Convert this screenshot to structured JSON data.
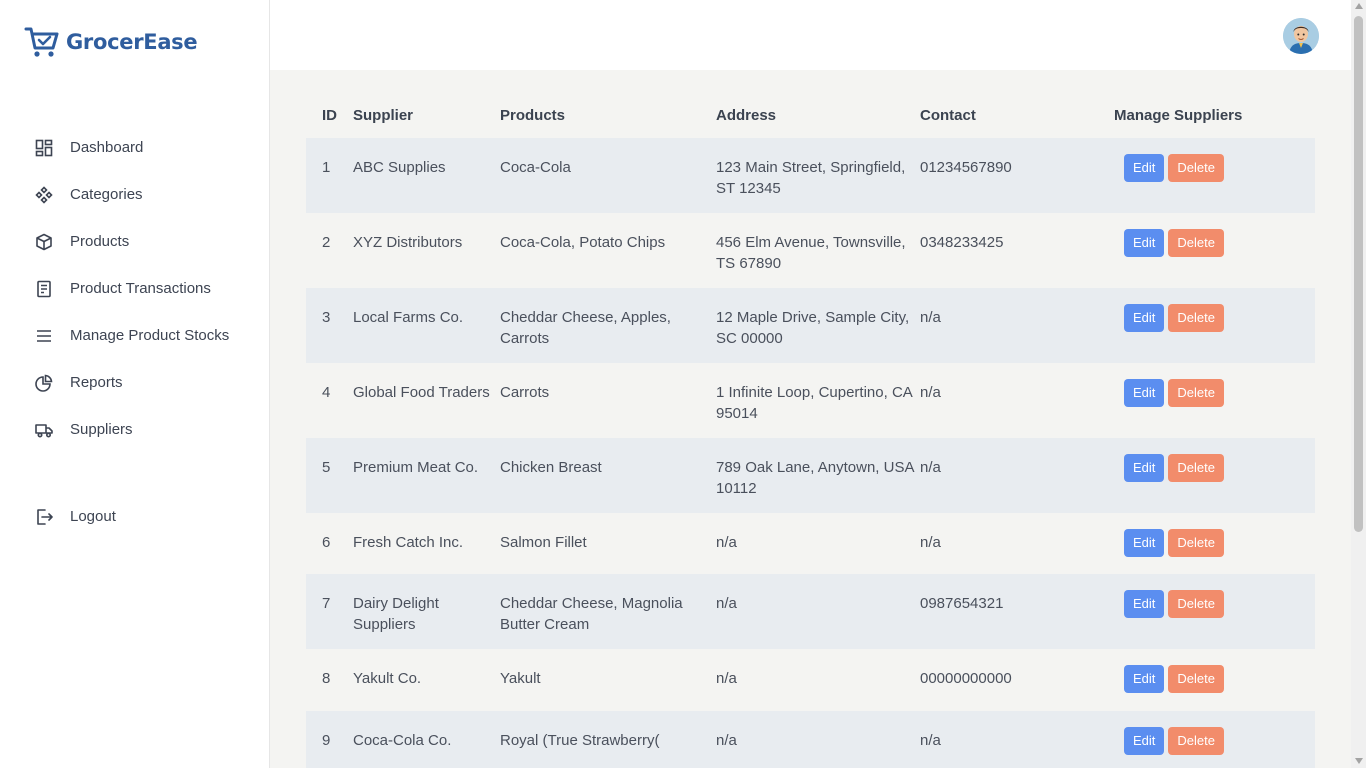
{
  "brand": {
    "name": "GrocerEase",
    "icon": "cart-icon",
    "color": "#2f5d9e"
  },
  "nav": {
    "items": [
      {
        "label": "Dashboard",
        "icon": "dashboard-icon"
      },
      {
        "label": "Categories",
        "icon": "categories-icon"
      },
      {
        "label": "Products",
        "icon": "box-icon"
      },
      {
        "label": "Product Transactions",
        "icon": "receipt-icon"
      },
      {
        "label": "Manage Product Stocks",
        "icon": "menu-icon"
      },
      {
        "label": "Reports",
        "icon": "pie-chart-icon"
      },
      {
        "label": "Suppliers",
        "icon": "truck-icon"
      }
    ],
    "logout": {
      "label": "Logout",
      "icon": "logout-icon"
    }
  },
  "table": {
    "headers": [
      "ID",
      "Supplier",
      "Products",
      "Address",
      "Contact",
      "Manage Suppliers"
    ],
    "edit_label": "Edit",
    "delete_label": "Delete",
    "rows": [
      {
        "id": "1",
        "supplier": "ABC Supplies",
        "products": "Coca-Cola",
        "address": "123 Main Street, Springfield, ST 12345",
        "contact": "01234567890"
      },
      {
        "id": "2",
        "supplier": "XYZ Distributors",
        "products": "Coca-Cola, Potato Chips",
        "address": "456 Elm Avenue, Townsville, TS 67890",
        "contact": "0348233425"
      },
      {
        "id": "3",
        "supplier": "Local Farms Co.",
        "products": "Cheddar Cheese, Apples, Carrots",
        "address": "12 Maple Drive, Sample City, SC 00000",
        "contact": "n/a"
      },
      {
        "id": "4",
        "supplier": "Global Food Traders",
        "products": "Carrots",
        "address": "1 Infinite Loop, Cupertino, CA 95014",
        "contact": "n/a"
      },
      {
        "id": "5",
        "supplier": "Premium Meat Co.",
        "products": "Chicken Breast",
        "address": "789 Oak Lane, Anytown, USA 10112",
        "contact": "n/a"
      },
      {
        "id": "6",
        "supplier": "Fresh Catch Inc.",
        "products": "Salmon Fillet",
        "address": "n/a",
        "contact": "n/a"
      },
      {
        "id": "7",
        "supplier": "Dairy Delight Suppliers",
        "products": "Cheddar Cheese, Magnolia Butter Cream",
        "address": "n/a",
        "contact": "0987654321"
      },
      {
        "id": "8",
        "supplier": "Yakult Co.",
        "products": "Yakult",
        "address": "n/a",
        "contact": "00000000000"
      },
      {
        "id": "9",
        "supplier": "Coca-Cola Co.",
        "products": "Royal (True Strawberry(",
        "address": "n/a",
        "contact": "n/a"
      }
    ]
  },
  "colors": {
    "edit": "#5b8ef0",
    "delete": "#f28c6b",
    "row_alt": "#e8ecf0",
    "main_bg": "#f4f4f2"
  }
}
